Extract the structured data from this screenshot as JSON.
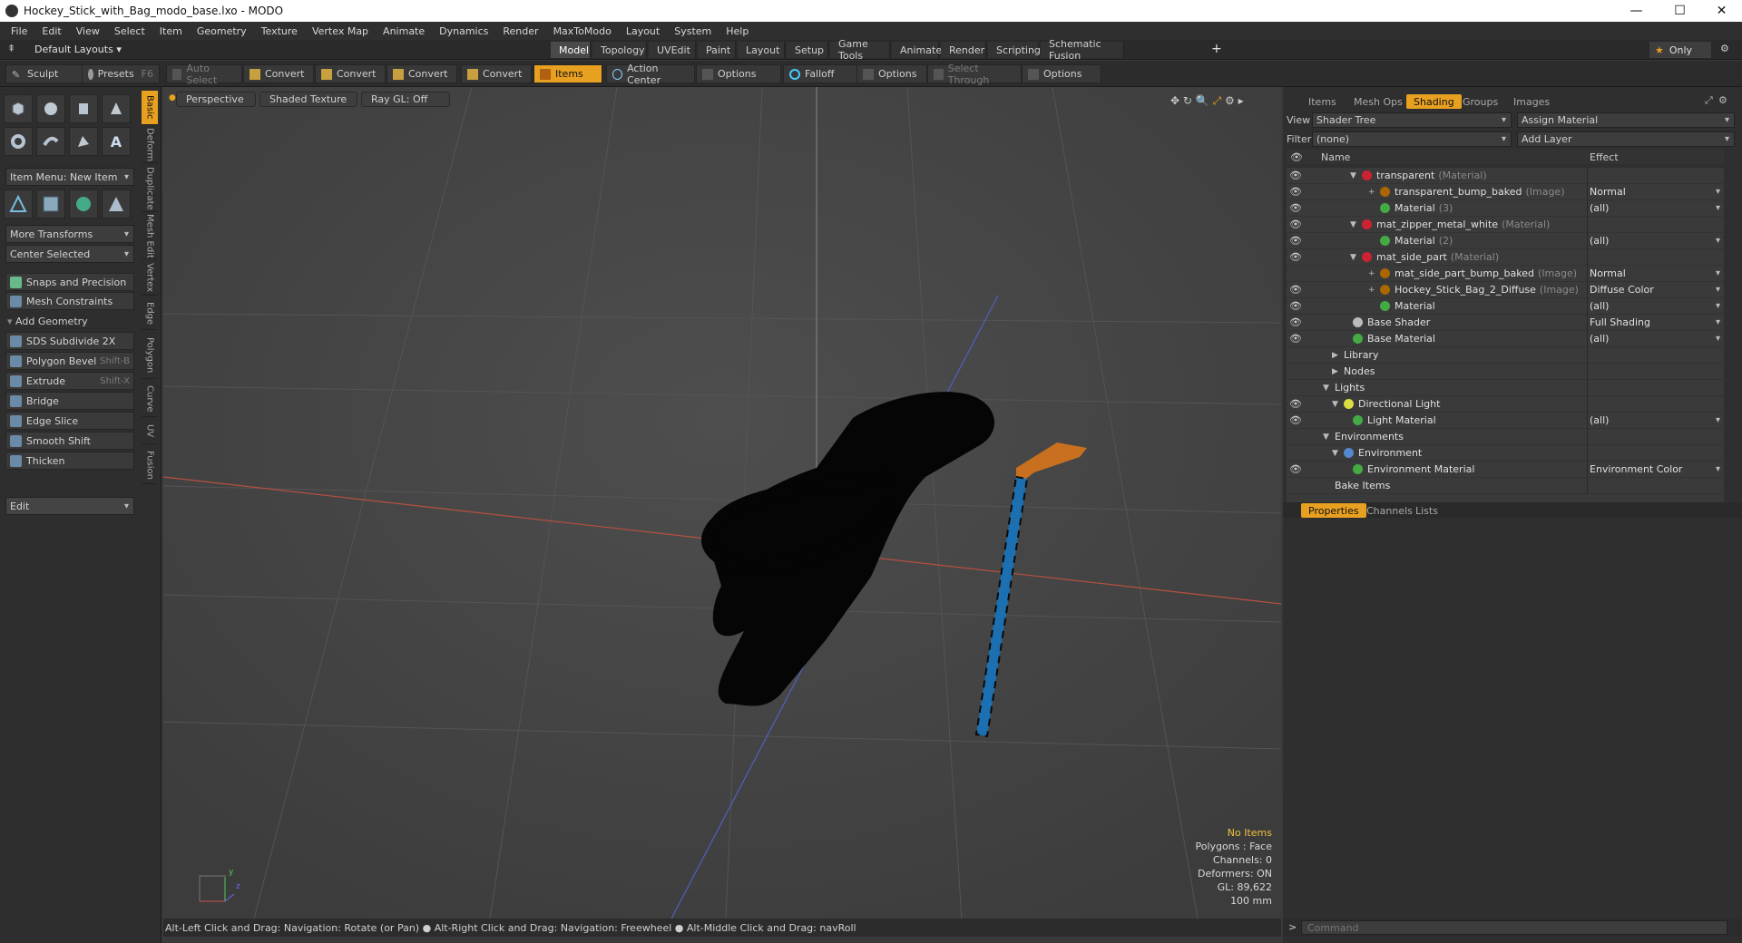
{
  "window": {
    "title": "Hockey_Stick_with_Bag_modo_base.lxo - MODO"
  },
  "menu": [
    "File",
    "Edit",
    "View",
    "Select",
    "Item",
    "Geometry",
    "Texture",
    "Vertex Map",
    "Animate",
    "Dynamics",
    "Render",
    "MaxToModo",
    "Layout",
    "System",
    "Help"
  ],
  "layout": {
    "preset": "Default Layouts",
    "tabs": [
      "Model",
      "Topology",
      "UVEdit",
      "Paint",
      "Layout",
      "Setup",
      "Game Tools",
      "Animate",
      "Render",
      "Scripting",
      "Schematic Fusion"
    ],
    "active_tab": "Model",
    "only_label": "Only"
  },
  "toolbar": {
    "sculpt": "Sculpt",
    "presets": "Presets",
    "presets_key": "F6",
    "auto_select": "Auto Select",
    "convert": "Convert",
    "items": "Items",
    "action_center": "Action Center",
    "options": "Options",
    "falloff": "Falloff",
    "select_through": "Select Through"
  },
  "left": {
    "item_menu": "Item Menu: New Item",
    "more_transforms": "More Transforms",
    "center_selected": "Center Selected",
    "snaps": "Snaps and Precision",
    "mesh_constraints": "Mesh Constraints",
    "add_geometry": "Add Geometry",
    "tools": [
      {
        "label": "SDS Subdivide 2X",
        "key": ""
      },
      {
        "label": "Polygon Bevel",
        "key": "Shift-B"
      },
      {
        "label": "Extrude",
        "key": "Shift-X"
      },
      {
        "label": "Bridge",
        "key": ""
      },
      {
        "label": "Edge Slice",
        "key": ""
      },
      {
        "label": "Smooth Shift",
        "key": ""
      },
      {
        "label": "Thicken",
        "key": ""
      }
    ],
    "edit": "Edit",
    "vtabs": [
      "Basic",
      "Deform",
      "Duplicate",
      "Mesh Edit",
      "Vertex",
      "Edge",
      "Polygon",
      "Curve",
      "UV",
      "Fusion"
    ]
  },
  "viewport": {
    "perspective": "Perspective",
    "shading": "Shaded Texture",
    "raygl": "Ray GL: Off",
    "hud": {
      "no_items": "No Items",
      "polygons": "Polygons : Face",
      "channels": "Channels: 0",
      "deformers": "Deformers: ON",
      "gl": "GL: 89,622",
      "scale": "100 mm"
    }
  },
  "status": "Alt-Left Click and Drag: Navigation: Rotate (or Pan) ● Alt-Right Click and Drag: Navigation: Freewheel ● Alt-Middle Click and Drag: navRoll",
  "right": {
    "tabs": [
      "Items",
      "Mesh Ops",
      "Shading",
      "Groups",
      "Images"
    ],
    "active_tab": "Shading",
    "view_label": "View",
    "view_value": "Shader Tree",
    "assign_material": "Assign Material",
    "filter_label": "Filter",
    "filter_value": "(none)",
    "add_layer": "Add Layer",
    "col_name": "Name",
    "col_effect": "Effect",
    "tree": [
      {
        "name": "transparent",
        "type": "(Material)",
        "effect": "",
        "eye": true,
        "indent": 1,
        "tri": "▼",
        "ball": "#c23"
      },
      {
        "name": "transparent_bump_baked",
        "type": "(Image)",
        "effect": "Normal",
        "eye": true,
        "indent": 3,
        "tri": "+",
        "ball": "#a60"
      },
      {
        "name": "Material",
        "type": "(3)",
        "effect": "(all)",
        "eye": true,
        "indent": 3,
        "tri": "",
        "ball": "#4a4"
      },
      {
        "name": "mat_zipper_metal_white",
        "type": "(Material)",
        "effect": "",
        "eye": true,
        "indent": 1,
        "tri": "▼",
        "ball": "#c23"
      },
      {
        "name": "Material",
        "type": "(2)",
        "effect": "(all)",
        "eye": true,
        "indent": 3,
        "tri": "",
        "ball": "#4a4"
      },
      {
        "name": "mat_side_part",
        "type": "(Material)",
        "effect": "",
        "eye": true,
        "indent": 1,
        "tri": "▼",
        "ball": "#c23"
      },
      {
        "name": "mat_side_part_bump_baked",
        "type": "(Image)",
        "effect": "Normal",
        "eye": false,
        "indent": 3,
        "tri": "+",
        "ball": "#a60"
      },
      {
        "name": "Hockey_Stick_Bag_2_Diffuse",
        "type": "(Image)",
        "effect": "Diffuse Color",
        "eye": true,
        "indent": 3,
        "tri": "+",
        "ball": "#a60"
      },
      {
        "name": "Material",
        "type": "",
        "effect": "(all)",
        "eye": true,
        "indent": 3,
        "tri": "",
        "ball": "#4a4"
      },
      {
        "name": "Base Shader",
        "type": "",
        "effect": "Full Shading",
        "eye": true,
        "indent": 0,
        "tri": "",
        "ball": "#bbb"
      },
      {
        "name": "Base Material",
        "type": "",
        "effect": "(all)",
        "eye": true,
        "indent": 0,
        "tri": "",
        "ball": "#4a4"
      },
      {
        "name": "Library",
        "type": "",
        "effect": "",
        "eye": false,
        "indent": -1,
        "tri": "▶",
        "ball": ""
      },
      {
        "name": "Nodes",
        "type": "",
        "effect": "",
        "eye": false,
        "indent": -1,
        "tri": "▶",
        "ball": ""
      },
      {
        "name": "Lights",
        "type": "",
        "effect": "",
        "eye": false,
        "indent": -2,
        "tri": "▼",
        "ball": ""
      },
      {
        "name": "Directional Light",
        "type": "",
        "effect": "",
        "eye": true,
        "indent": -1,
        "tri": "▼",
        "ball": "#dd4"
      },
      {
        "name": "Light Material",
        "type": "",
        "effect": "(all)",
        "eye": true,
        "indent": 0,
        "tri": "",
        "ball": "#4a4"
      },
      {
        "name": "Environments",
        "type": "",
        "effect": "",
        "eye": false,
        "indent": -2,
        "tri": "▼",
        "ball": ""
      },
      {
        "name": "Environment",
        "type": "",
        "effect": "",
        "eye": false,
        "indent": -1,
        "tri": "▼",
        "ball": "#58c"
      },
      {
        "name": "Environment Material",
        "type": "",
        "effect": "Environment Color",
        "eye": true,
        "indent": 0,
        "tri": "",
        "ball": "#4a4"
      },
      {
        "name": "Bake Items",
        "type": "",
        "effect": "",
        "eye": false,
        "indent": -2,
        "tri": "",
        "ball": ""
      }
    ],
    "bottom_tabs": [
      "Properties",
      "Channels",
      "Lists"
    ],
    "command_placeholder": "Command"
  }
}
